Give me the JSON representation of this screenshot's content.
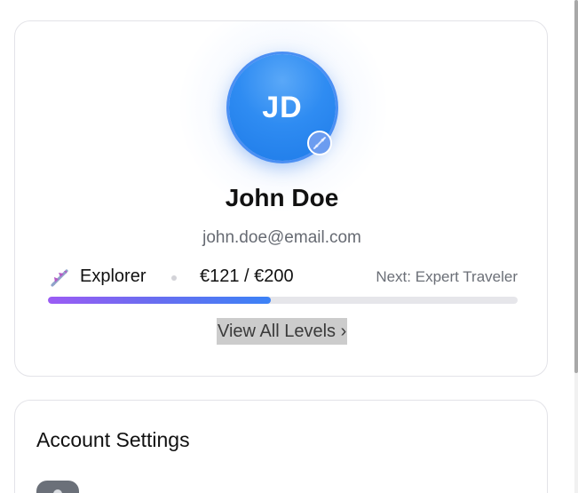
{
  "profile": {
    "initials": "JD",
    "name": "John Doe",
    "email": "john.doe@email.com",
    "avatar_badge_icon": "airplane-icon"
  },
  "level": {
    "icon": "airplane-icon",
    "name": "Explorer",
    "amount": "€121 / €200",
    "next": "Next: Expert Traveler",
    "progress": 0.474,
    "view_all_label": "View All Levels ›"
  },
  "settings": {
    "title": "Account Settings"
  },
  "colors": {
    "accent": "#3b82f6",
    "avatar": "#2f8cf2",
    "progress_start": "#9b5cf4",
    "progress_end": "#3b82f6"
  }
}
